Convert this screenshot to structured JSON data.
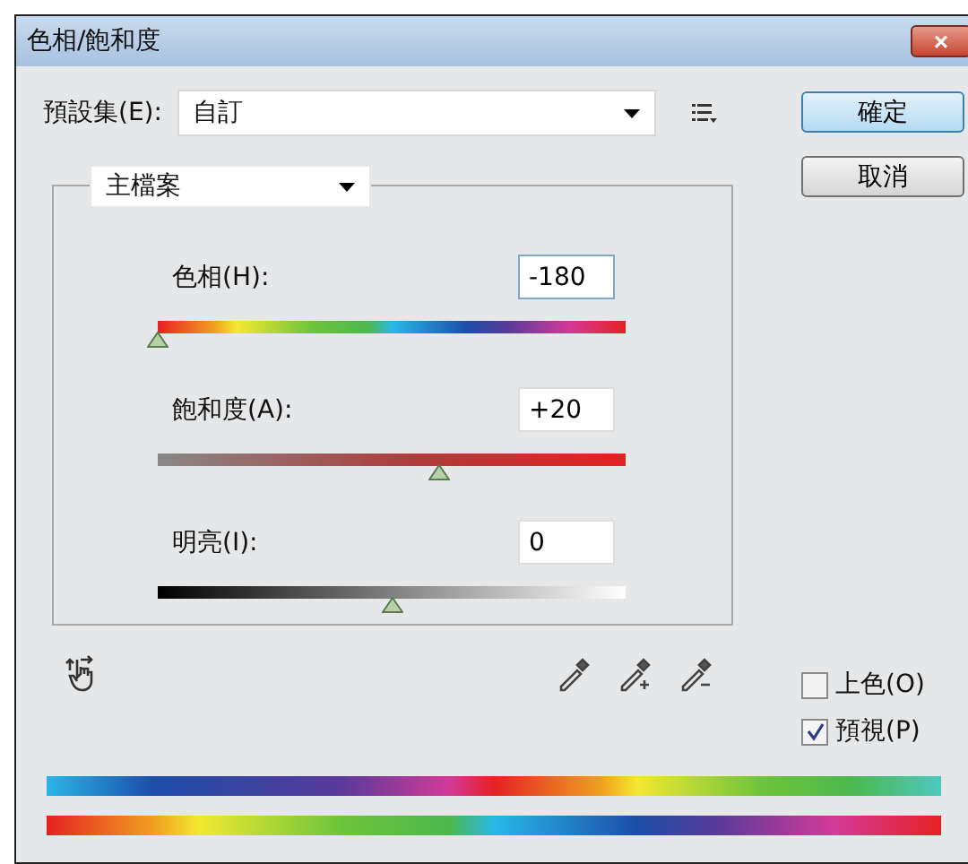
{
  "window": {
    "title": "色相/飽和度",
    "close": "×"
  },
  "preset": {
    "label": "預設集(E):",
    "value": "自訂"
  },
  "buttons": [
    {
      "label": "確定",
      "selected": true
    },
    {
      "label": "取消",
      "selected": false
    }
  ],
  "channel": {
    "value": "主檔案"
  },
  "sliders": [
    {
      "label": "色相(H):",
      "value": "-180",
      "kind": "hue",
      "level": 0,
      "selected": true
    },
    {
      "label": "飽和度(A):",
      "value": "+20",
      "kind": "saturation",
      "level": 0.6,
      "selected": false
    },
    {
      "label": "明亮(I):",
      "value": "0",
      "kind": "lightness",
      "level": 0.5,
      "selected": false
    }
  ],
  "checkboxes": [
    {
      "label": "上色(O)",
      "checked": false
    },
    {
      "label": "預視(P)",
      "checked": true
    }
  ]
}
